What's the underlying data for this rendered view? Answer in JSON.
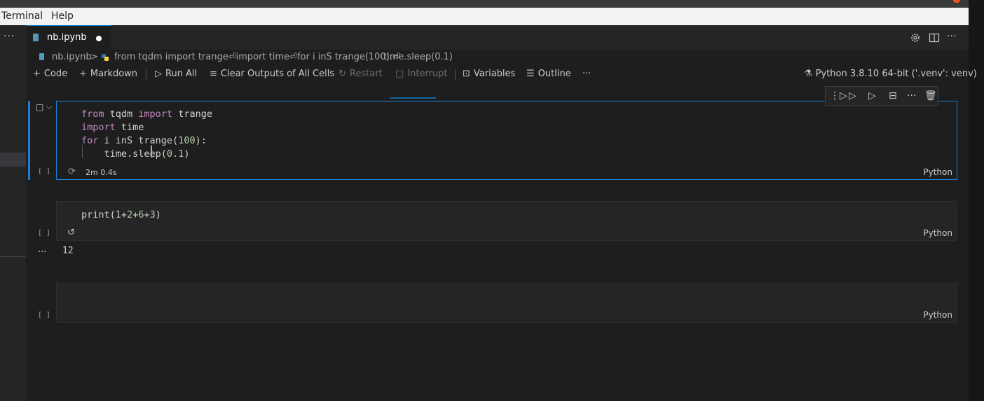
{
  "menu": [
    "Terminal",
    "Help"
  ],
  "sidebar": {
    "more": "···"
  },
  "tab": {
    "filename": "nb.ipynb"
  },
  "editor_actions": {
    "more": "···"
  },
  "breadcrumb": {
    "file": "nb.ipynb",
    "sep": ">",
    "cell": "from tqdm import trange⏎import time⏎for i inS trange(100):⏎",
    "line": "time.sleep(0.1)"
  },
  "toolbar": {
    "code": "Code",
    "markdown": "Markdown",
    "run_all": "Run All",
    "clear_outputs": "Clear Outputs of All Cells",
    "restart": "Restart",
    "interrupt": "Interrupt",
    "variables": "Variables",
    "outline": "Outline",
    "more": "···",
    "kernel": "Python 3.8.10 64-bit ('.venv': venv)"
  },
  "cells": [
    {
      "exec_count": "[ ]",
      "lines": [
        [
          [
            "kw",
            "from"
          ],
          [
            "t",
            " tqdm "
          ],
          [
            "kw",
            "import"
          ],
          [
            "t",
            " trange"
          ]
        ],
        [
          [
            "kw",
            "import"
          ],
          [
            "t",
            " time"
          ]
        ],
        [
          [
            "kw",
            "for"
          ],
          [
            "t",
            " i inS trange("
          ],
          [
            "num",
            "100"
          ],
          [
            "t",
            "):"
          ]
        ],
        [
          [
            "t",
            "    time.sleep("
          ],
          [
            "num",
            "0.1"
          ],
          [
            "t",
            ")"
          ]
        ]
      ],
      "status_time": "2m 0.4s",
      "language": "Python"
    },
    {
      "exec_count": "[ ]",
      "lines": [
        [
          [
            "t",
            "print("
          ],
          [
            "num",
            "1"
          ],
          [
            "t",
            "+"
          ],
          [
            "num",
            "2"
          ],
          [
            "t",
            "+"
          ],
          [
            "num",
            "6"
          ],
          [
            "t",
            "+"
          ],
          [
            "num",
            "3"
          ],
          [
            "t",
            ")"
          ]
        ]
      ],
      "output": "12",
      "output_more": "···",
      "language": "Python"
    },
    {
      "exec_count": "[ ]",
      "lines": [],
      "language": "Python"
    }
  ],
  "cell_toolbar": {
    "more": "···"
  },
  "colors": {
    "accent": "#0078d4",
    "focus_border": "#1d7fd6",
    "keyword": "#c586c0",
    "number": "#b5cea8"
  }
}
